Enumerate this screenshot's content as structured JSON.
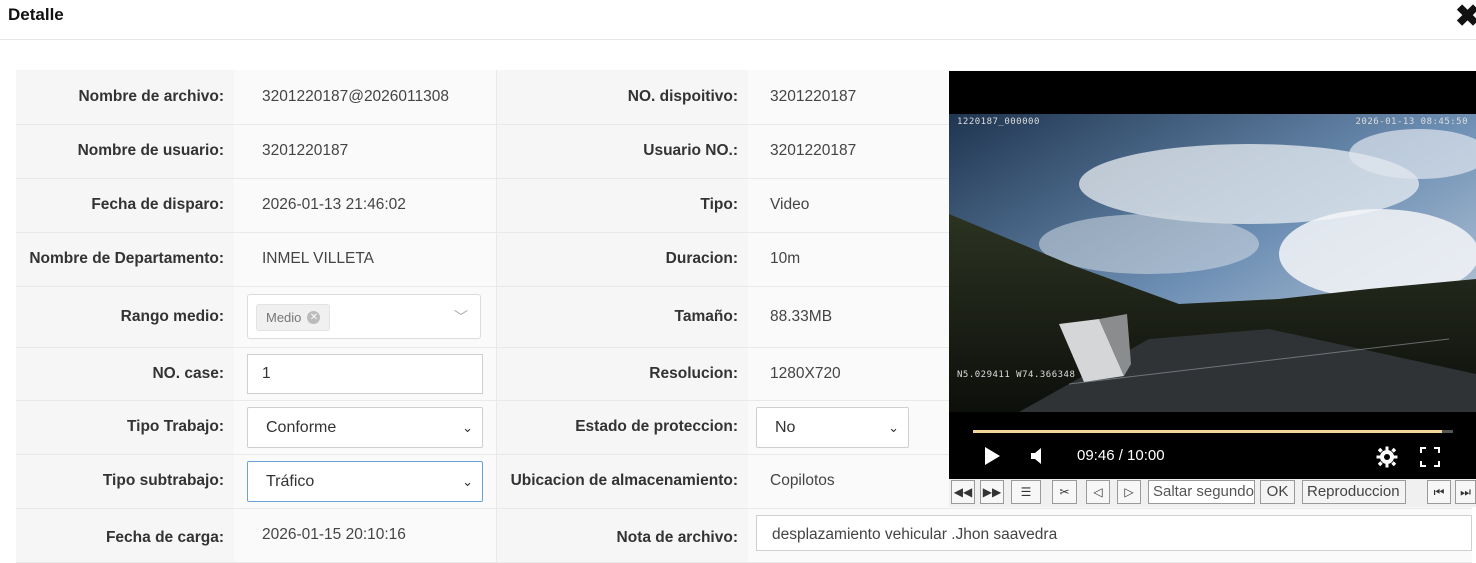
{
  "dialog": {
    "title": "Detalle",
    "close_icon": "close-icon"
  },
  "fields": {
    "file_name": {
      "label": "Nombre de archivo:",
      "value": "3201220187@2026011308"
    },
    "device_no": {
      "label": "NO. dispoitivo:",
      "value": "3201220187"
    },
    "user_name": {
      "label": "Nombre de usuario:",
      "value": "3201220187"
    },
    "user_no": {
      "label": "Usuario NO.:",
      "value": "3201220187"
    },
    "trigger_date": {
      "label": "Fecha de disparo:",
      "value": "2026-01-13 21:46:02"
    },
    "type": {
      "label": "Tipo:",
      "value": "Video"
    },
    "department": {
      "label": "Nombre de Departamento:",
      "value": "INMEL VILLETA"
    },
    "duration": {
      "label": "Duracion:",
      "value": "10m"
    },
    "range": {
      "label": "Rango medio:",
      "tag": "Medio"
    },
    "size": {
      "label": "Tamaño:",
      "value": "88.33MB"
    },
    "case_no": {
      "label": "NO. case:",
      "value": "1"
    },
    "resolution": {
      "label": "Resolucion:",
      "value": "1280X720"
    },
    "work_type": {
      "label": "Tipo Trabajo:",
      "value": "Conforme"
    },
    "protection": {
      "label": "Estado de proteccion:",
      "value": "No"
    },
    "subwork_type": {
      "label": "Tipo subtrabajo:",
      "value": "Tráfico"
    },
    "storage": {
      "label": "Ubicacion de almacenamiento:",
      "value": "Copilotos"
    },
    "upload_date": {
      "label": "Fecha de carga:",
      "value": "2026-01-15 20:10:16"
    },
    "file_note": {
      "label": "Nota de archivo:",
      "value": "desplazamiento vehicular .Jhon saavedra"
    }
  },
  "video": {
    "osd_top_left": "1220187_000000",
    "osd_top_right": "2026-01-13 08:45:50",
    "osd_coords": "N5.029411 W74.366348",
    "time": "09:46 / 10:00",
    "progress_fraction": 0.977
  },
  "toolbar": {
    "seek_placeholder": "Saltar segundos",
    "ok_label": "OK",
    "play_label": "Reproduccion"
  }
}
